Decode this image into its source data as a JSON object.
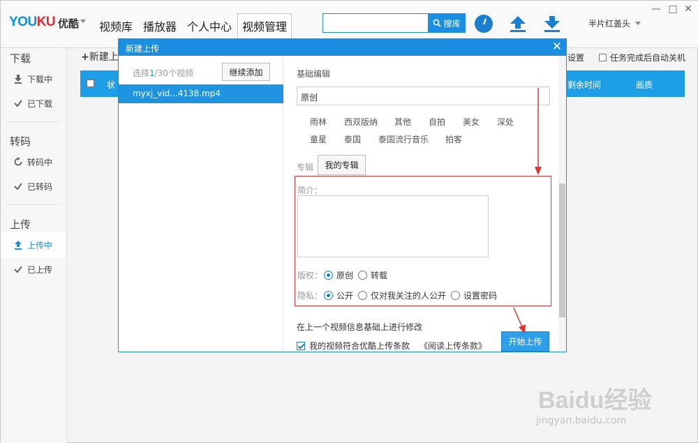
{
  "app": {
    "logo_en_a": "YOU",
    "logo_en_b": "KU",
    "logo_cn": "优酷"
  },
  "nav": {
    "items": [
      {
        "label": "视频库"
      },
      {
        "label": "播放器"
      },
      {
        "label": "个人中心"
      },
      {
        "label": "视频管理"
      }
    ],
    "active_index": 3
  },
  "search": {
    "value": "",
    "button_label": "搜库"
  },
  "header": {
    "username": "半片红盖头",
    "history_icon": "clock-icon",
    "upload_icon": "upload-arrow-icon",
    "download_icon": "download-arrow-icon"
  },
  "sidebar": {
    "sections": [
      {
        "heading": "下载",
        "items": [
          {
            "label": "下载中",
            "icon": "download-icon"
          },
          {
            "label": "已下载",
            "icon": "check-icon"
          }
        ]
      },
      {
        "heading": "转码",
        "items": [
          {
            "label": "转码中",
            "icon": "refresh-icon"
          },
          {
            "label": "已转码",
            "icon": "check-icon"
          }
        ]
      },
      {
        "heading": "上传",
        "items": [
          {
            "label": "上传中",
            "icon": "upload-icon"
          },
          {
            "label": "已上传",
            "icon": "check-icon"
          }
        ]
      }
    ],
    "active": "上传中"
  },
  "main": {
    "new_upload_label": "新建上",
    "settings_label": "设置",
    "auto_shutdown_label": "任务完成后自动关机",
    "table_headers": {
      "status": "状",
      "remaining": "剩余时间",
      "quality": "画质"
    }
  },
  "dialog": {
    "title": "新建上传",
    "selected_prefix": "选择",
    "selected_count": "1",
    "selected_suffix": "/30个视频",
    "continue_add_label": "继续添加",
    "file_name": "myxj_vid...4138.mp4",
    "basic_edit_label": "基础编辑",
    "title_field_value": "原创",
    "tags": [
      "雨林",
      "西双版纳",
      "其他",
      "自拍",
      "美女",
      "深处",
      "童星",
      "泰国",
      "泰国流行音乐",
      "拍客"
    ],
    "album_label": "专辑",
    "my_album_label": "我的专辑",
    "intro_label": "简介：",
    "intro_value": "",
    "copyright_label": "版权：",
    "copyright_options": [
      "原创",
      "转载"
    ],
    "copyright_selected": "原创",
    "privacy_label": "隐私：",
    "privacy_options": [
      "公开",
      "仅对我关注的人公开",
      "设置密码"
    ],
    "privacy_selected": "公开",
    "modify_prev_label": "在上一个视频信息基础上进行修改",
    "agree_label": "我的视频符合优酷上传条款",
    "agree_checked": true,
    "terms_link": "《阅读上传条款》",
    "start_upload_label": "开始上传",
    "annotation_color": "#e53030"
  },
  "colors": {
    "brand_blue": "#1a8ee0",
    "table_blue": "#1f9ee8",
    "logo_red": "#e8262d"
  },
  "watermark": {
    "brand": "Baidu经验",
    "url": "jingyan.baidu.com"
  }
}
